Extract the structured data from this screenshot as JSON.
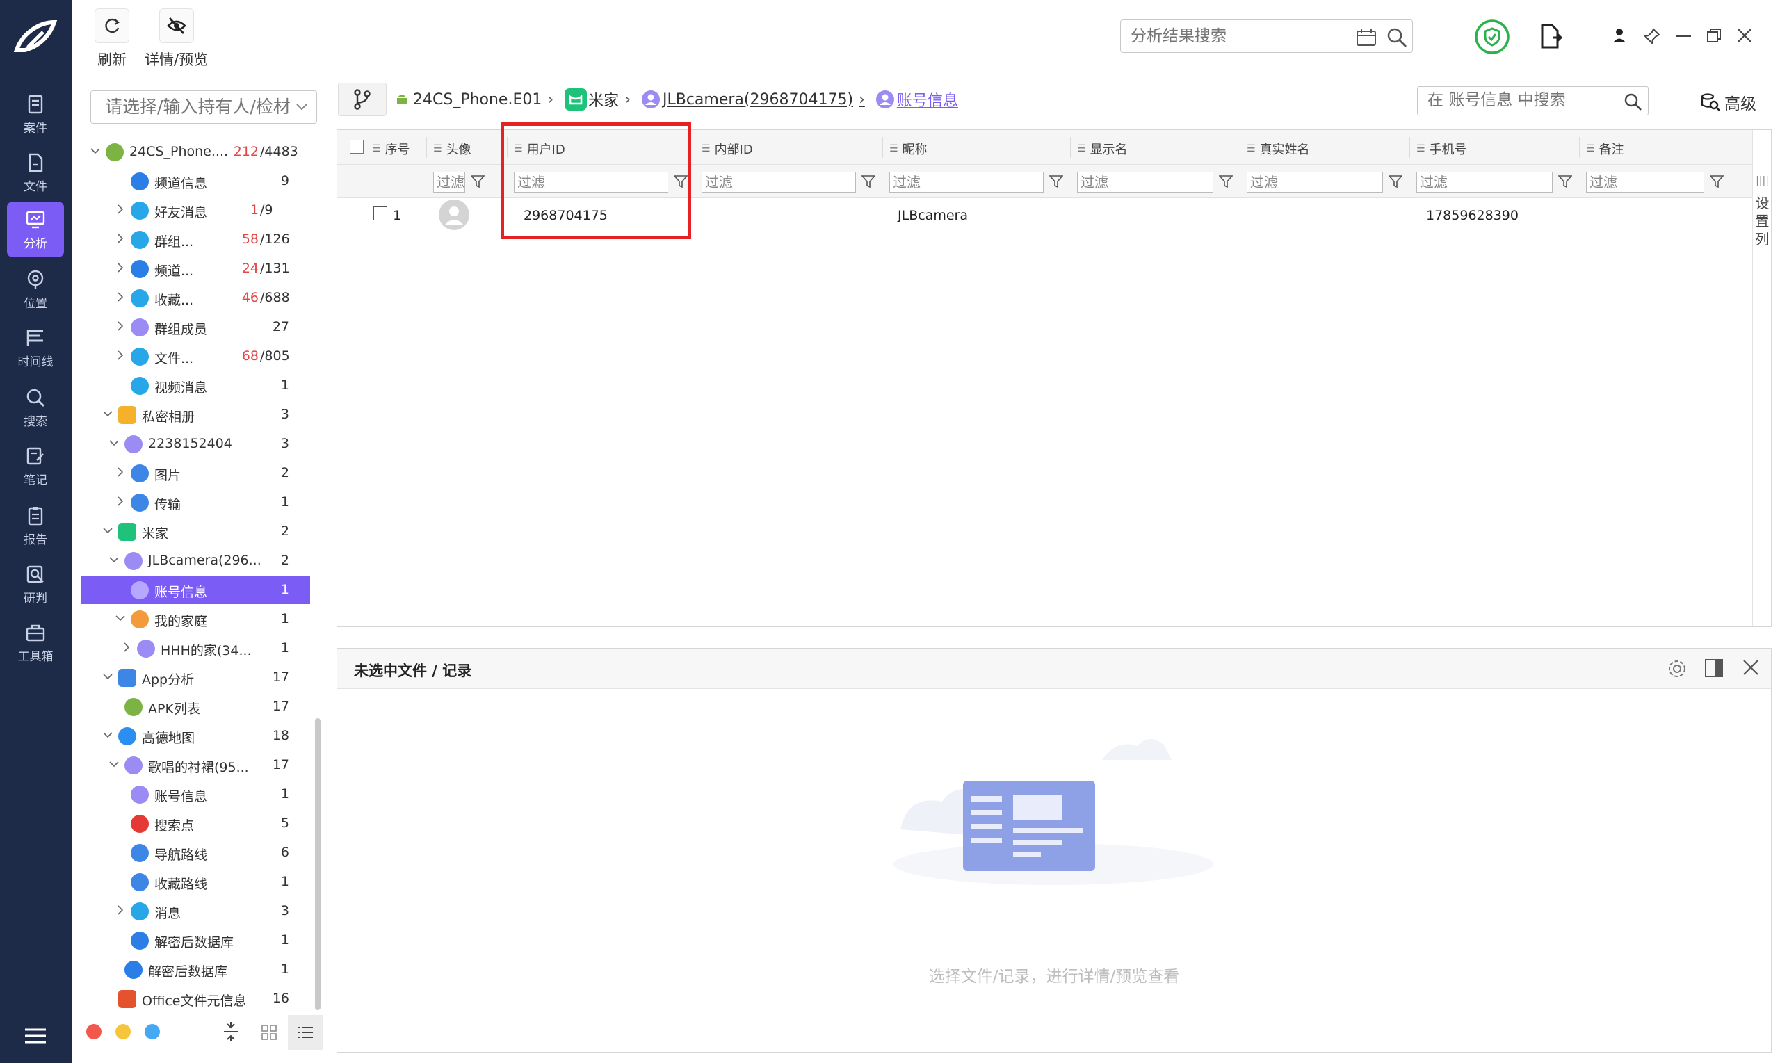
{
  "toolbar": {
    "refresh_label": "刷新",
    "preview_label": "详情/预览"
  },
  "top_search": {
    "placeholder": "分析结果搜索"
  },
  "rail": {
    "items": [
      {
        "label": "案件",
        "icon": "case-icon"
      },
      {
        "label": "文件",
        "icon": "file-icon"
      },
      {
        "label": "分析",
        "icon": "analysis-icon"
      },
      {
        "label": "位置",
        "icon": "location-icon"
      },
      {
        "label": "时间线",
        "icon": "timeline-icon"
      },
      {
        "label": "搜索",
        "icon": "search-icon"
      },
      {
        "label": "笔记",
        "icon": "note-icon"
      },
      {
        "label": "报告",
        "icon": "report-icon"
      },
      {
        "label": "研判",
        "icon": "judge-icon"
      },
      {
        "label": "工具箱",
        "icon": "toolbox-icon"
      }
    ],
    "active": "分析"
  },
  "tree": {
    "search_placeholder": "请选择/输入持有人/检材",
    "rows": [
      {
        "label": "24CS_Phone....",
        "red": "212",
        "count": "/4483",
        "icon": "android-icon"
      },
      {
        "label": "频道信息",
        "red": "",
        "count": "9",
        "icon": "megaphone-icon"
      },
      {
        "label": "好友消息",
        "red": "1",
        "count": "/9",
        "icon": "chat-icon"
      },
      {
        "label": "群组...",
        "red": "58",
        "count": "/126",
        "icon": "chat-icon"
      },
      {
        "label": "频道...",
        "red": "24",
        "count": "/131",
        "icon": "megaphone-icon"
      },
      {
        "label": "收藏...",
        "red": "46",
        "count": "/688",
        "icon": "chat-icon"
      },
      {
        "label": "群组成员",
        "red": "",
        "count": "27",
        "icon": "user-icon"
      },
      {
        "label": "文件...",
        "red": "68",
        "count": "/805",
        "icon": "chat-icon"
      },
      {
        "label": "视频消息",
        "red": "",
        "count": "1",
        "icon": "chat-icon"
      },
      {
        "label": "私密相册",
        "red": "",
        "count": "3",
        "icon": "album-icon"
      },
      {
        "label": "2238152404",
        "red": "",
        "count": "3",
        "icon": "user-icon"
      },
      {
        "label": "图片",
        "red": "",
        "count": "2",
        "icon": "image-icon"
      },
      {
        "label": "传输",
        "red": "",
        "count": "1",
        "icon": "list-icon"
      },
      {
        "label": "米家",
        "red": "",
        "count": "2",
        "icon": "mijia-icon"
      },
      {
        "label": "JLBcamera(296...",
        "red": "",
        "count": "2",
        "icon": "user-icon"
      },
      {
        "label": "账号信息",
        "red": "",
        "count": "1",
        "icon": "user-icon"
      },
      {
        "label": "我的家庭",
        "red": "",
        "count": "1",
        "icon": "family-icon"
      },
      {
        "label": "HHH的家(34...",
        "red": "",
        "count": "1",
        "icon": "user-icon"
      },
      {
        "label": "App分析",
        "red": "",
        "count": "17",
        "icon": "apps-icon"
      },
      {
        "label": "APK列表",
        "red": "",
        "count": "17",
        "icon": "android-icon"
      },
      {
        "label": "高德地图",
        "red": "",
        "count": "18",
        "icon": "amap-icon"
      },
      {
        "label": "歌唱的衬裙(95...",
        "red": "",
        "count": "17",
        "icon": "user-icon"
      },
      {
        "label": "账号信息",
        "red": "",
        "count": "1",
        "icon": "user-icon"
      },
      {
        "label": "搜索点",
        "red": "",
        "count": "5",
        "icon": "pin-icon"
      },
      {
        "label": "导航路线",
        "red": "",
        "count": "6",
        "icon": "route-icon"
      },
      {
        "label": "收藏路线",
        "red": "",
        "count": "1",
        "icon": "route-icon"
      },
      {
        "label": "消息",
        "red": "",
        "count": "3",
        "icon": "chat-icon"
      },
      {
        "label": "解密后数据库",
        "red": "",
        "count": "1",
        "icon": "database-icon"
      },
      {
        "label": "解密后数据库",
        "red": "",
        "count": "1",
        "icon": "database-icon"
      },
      {
        "label": "Office文件元信息",
        "red": "",
        "count": "16",
        "icon": "office-icon"
      }
    ]
  },
  "breadcrumb": {
    "items": [
      "24CS_Phone.E01",
      "米家",
      "JLBcamera(2968704175)",
      "账号信息"
    ]
  },
  "inner_search": {
    "placeholder": "在 账号信息 中搜索",
    "advanced_label": "高级"
  },
  "grid": {
    "columns": [
      "序号",
      "头像",
      "用户ID",
      "内部ID",
      "昵称",
      "显示名",
      "真实姓名",
      "手机号",
      "备注"
    ],
    "filter_placeholder": "过滤",
    "rows": [
      {
        "index": "1",
        "user_id": "2968704175",
        "internal_id": "",
        "nickname": "JLBcamera",
        "display_name": "",
        "real_name": "",
        "phone": "17859628390",
        "remark": ""
      }
    ],
    "set_columns_label": "设置列"
  },
  "detail": {
    "title": "未选中文件 / 记录",
    "empty_text": "选择文件/记录，进行详情/预览查看"
  },
  "colors": {
    "accent": "#7b5cf5",
    "rail": "#1d2a48",
    "red": "#e52222"
  }
}
